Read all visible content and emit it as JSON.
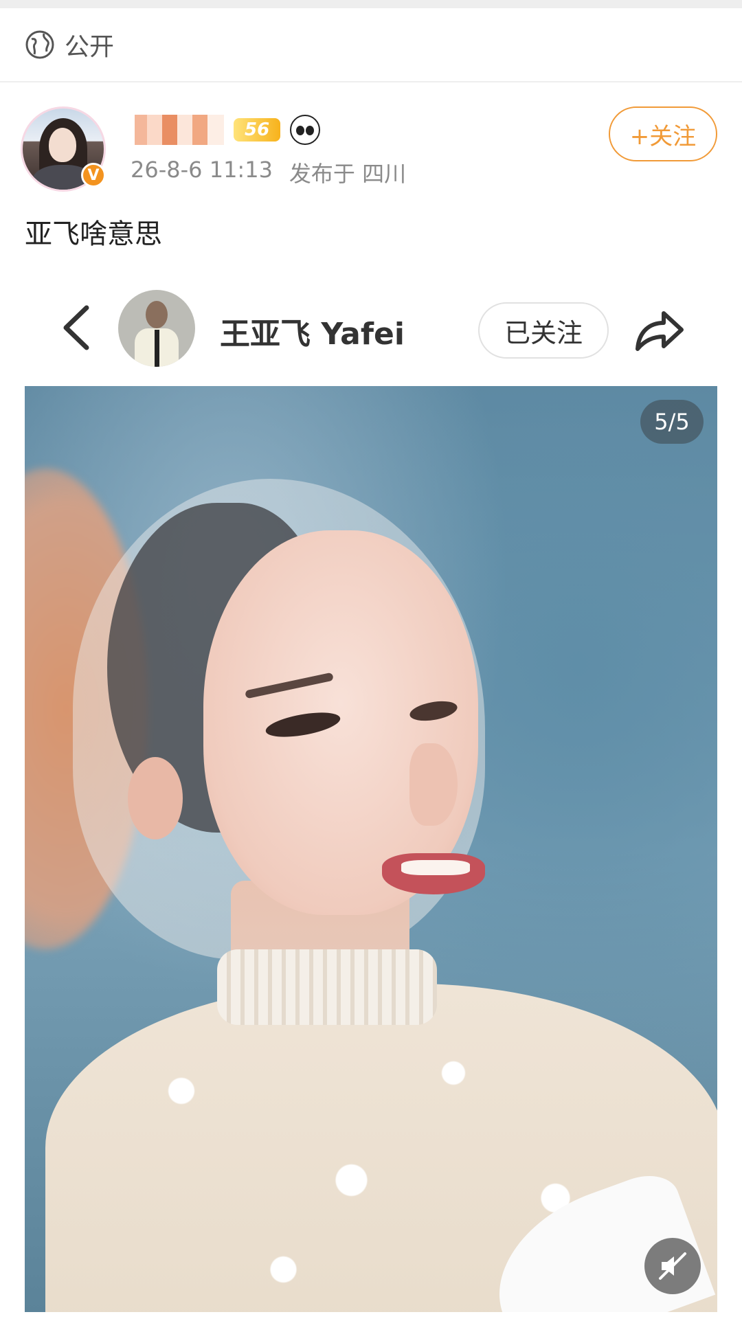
{
  "privacy": {
    "icon": "globe-icon",
    "label": "公开"
  },
  "post": {
    "author_name": "",
    "level_badge": "56",
    "timestamp": "26-8-6 11:13",
    "location": "发布于 四川",
    "follow_button": "+关注",
    "text": "亚飞啥意思",
    "accent_color": "#f19a37"
  },
  "embedded": {
    "back_icon": "chevron-left-icon",
    "profile_name": "王亚飞 Yafei",
    "followed_button": "已关注",
    "share_icon": "share-icon",
    "image_counter": "5/5",
    "mute_icon": "speaker-muted-icon"
  }
}
